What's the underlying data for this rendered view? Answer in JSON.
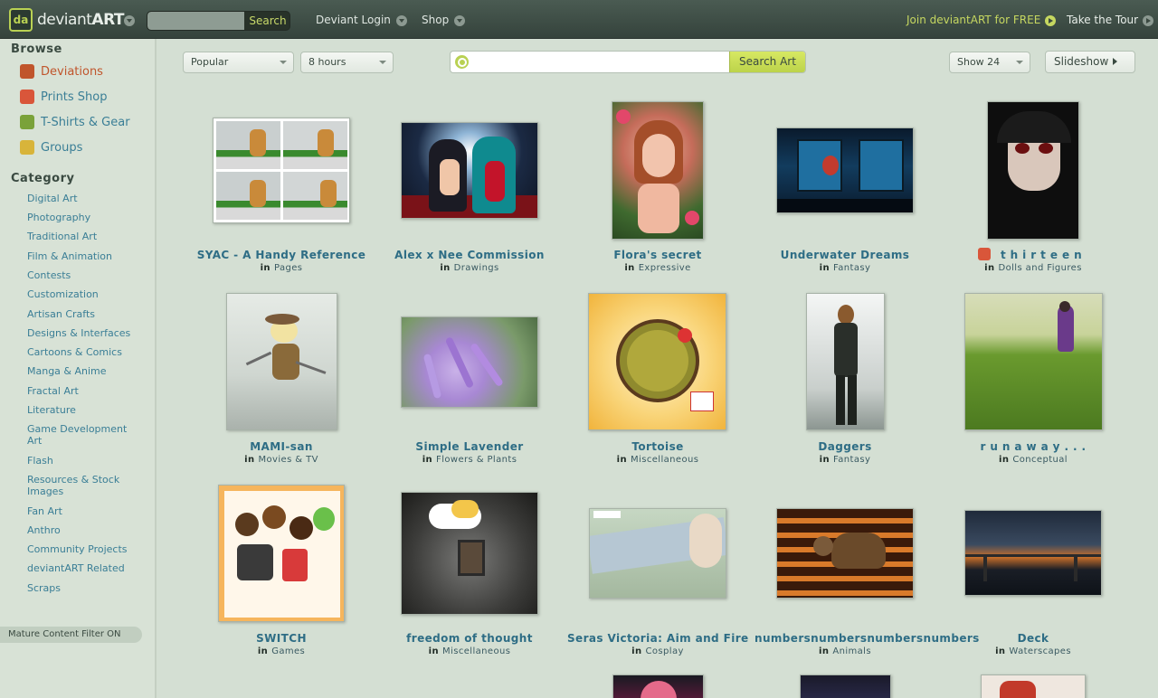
{
  "header": {
    "logo_text_a": "deviant",
    "logo_text_b": "ART",
    "search_button": "Search",
    "search_value": "",
    "nav": [
      "Deviant Login",
      "Shop"
    ],
    "join": "Join deviantART for FREE",
    "tour": "Take the Tour"
  },
  "sidebar": {
    "browse_heading": "Browse",
    "main": [
      {
        "label": "Deviations",
        "icon": "deviations-icon"
      },
      {
        "label": "Prints Shop",
        "icon": "prints-icon"
      },
      {
        "label": "T-Shirts & Gear",
        "icon": "tshirt-icon"
      },
      {
        "label": "Groups",
        "icon": "groups-icon"
      }
    ],
    "category_heading": "Category",
    "categories": [
      "Digital Art",
      "Photography",
      "Traditional Art",
      "Film & Animation",
      "Contests",
      "Customization",
      "Artisan Crafts",
      "Designs & Interfaces",
      "Cartoons & Comics",
      "Manga & Anime",
      "Fractal Art",
      "Literature",
      "Game Development Art",
      "Flash",
      "Resources & Stock Images",
      "Fan Art",
      "Anthro",
      "Community Projects",
      "deviantART Related",
      "Scraps"
    ],
    "mature_filter": "Mature Content Filter ON"
  },
  "filters": {
    "sort": "Popular",
    "time": "8 hours",
    "search_placeholder": "",
    "search_button": "Search Art",
    "show": "Show 24",
    "slideshow": "Slideshow"
  },
  "in_label": "in",
  "items": [
    {
      "title": "SYAC - A Handy Reference",
      "category": "Pages"
    },
    {
      "title": "Alex x Nee Commission",
      "category": "Drawings"
    },
    {
      "title": "Flora's secret",
      "category": "Expressive"
    },
    {
      "title": "Underwater Dreams",
      "category": "Fantasy"
    },
    {
      "title": "t h i r t e e n",
      "category": "Dolls and Figures"
    },
    {
      "title": "MAMI-san",
      "category": "Movies & TV"
    },
    {
      "title": "Simple Lavender",
      "category": "Flowers & Plants"
    },
    {
      "title": "Tortoise",
      "category": "Miscellaneous"
    },
    {
      "title": "Daggers",
      "category": "Fantasy"
    },
    {
      "title": "r u n a w a y . . .",
      "category": "Conceptual"
    },
    {
      "title": "SWITCH",
      "category": "Games"
    },
    {
      "title": "freedom of thought",
      "category": "Miscellaneous"
    },
    {
      "title": "Seras Victoria: Aim and Fire",
      "category": "Cosplay"
    },
    {
      "title": "numbersnumbersnumbersnumbers",
      "category": "Animals"
    },
    {
      "title": "Deck",
      "category": "Waterscapes"
    }
  ],
  "colors": {
    "topbar": "#3f4f46",
    "accent_green": "#b9d153",
    "link_blue": "#2e6d85",
    "active_orange": "#c0552c",
    "page_bg": "#d4dfd3"
  }
}
